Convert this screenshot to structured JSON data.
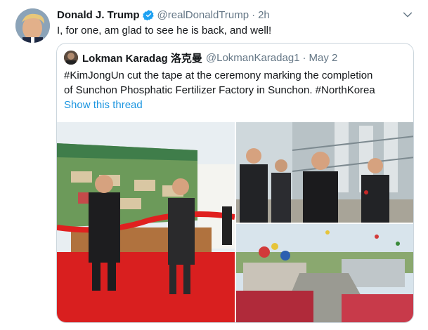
{
  "tweet": {
    "author_name": "Donald J. Trump",
    "handle": "@realDonaldTrump",
    "separator": "·",
    "time": "2h",
    "text": "I, for one, am glad to see he is back, and well!"
  },
  "quoted_tweet": {
    "author_name": "Lokman Karadag 洛克曼",
    "handle": "@LokmanKaradag1",
    "separator": "·",
    "time": "May 2",
    "text_line_1": "#KimJongUn cut the tape at the ceremony marking the completion",
    "text_line_2": "of Sunchon Phosphatic Fertilizer Factory in Sunchon. #NorthKorea",
    "show_thread": "Show this thread"
  },
  "colors": {
    "text": "#14171a",
    "secondary": "#657786",
    "link": "#1b95e0",
    "verified": "#1da1f2",
    "border": "#ccd6dd"
  },
  "icons": {
    "verified": "verified-badge-icon",
    "caret": "chevron-down-icon"
  }
}
